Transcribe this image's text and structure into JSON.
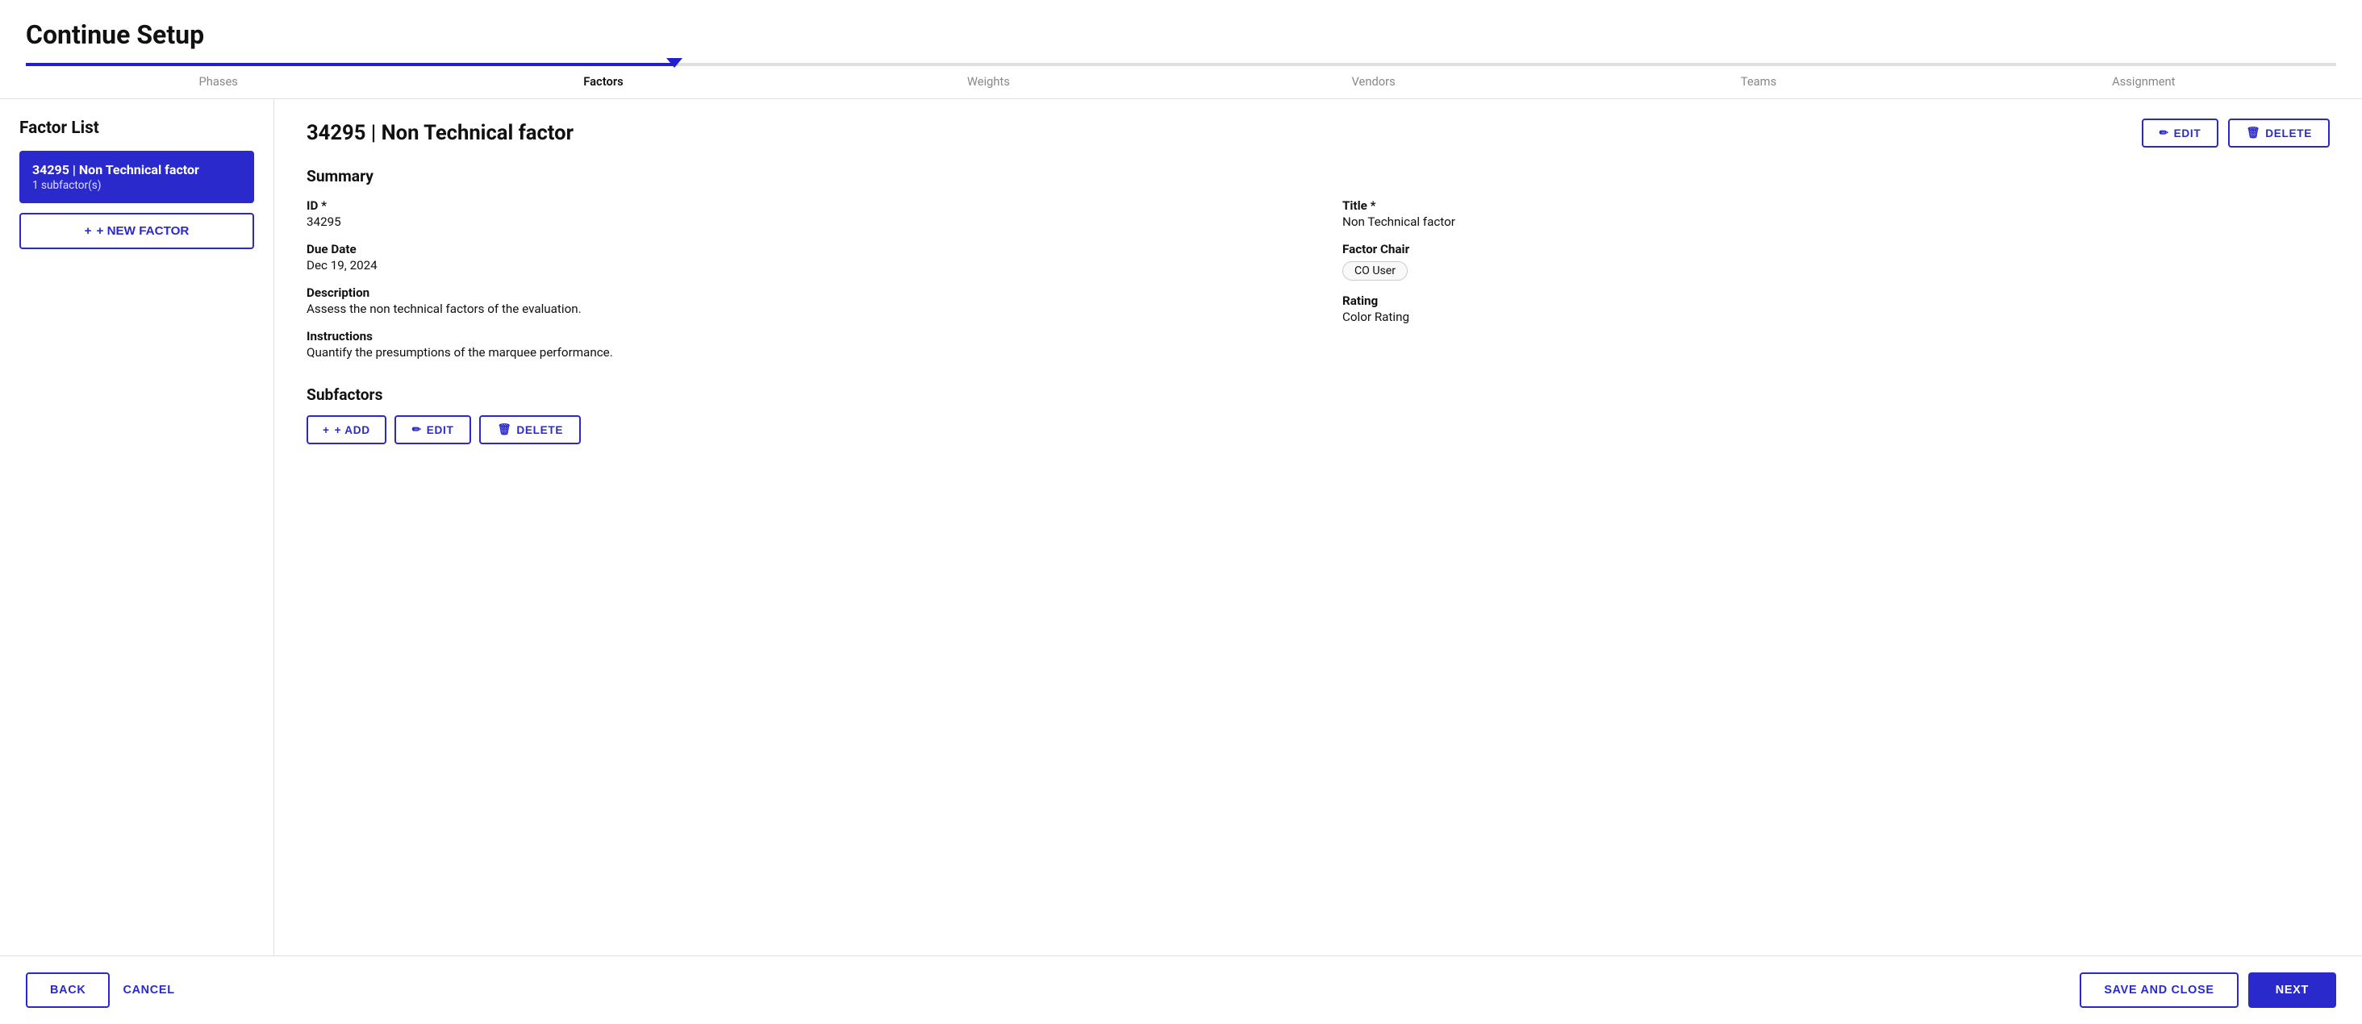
{
  "page": {
    "title": "Continue Setup"
  },
  "stepper": {
    "steps": [
      {
        "label": "Phases",
        "active": false
      },
      {
        "label": "Factors",
        "active": true
      },
      {
        "label": "Weights",
        "active": false
      },
      {
        "label": "Vendors",
        "active": false
      },
      {
        "label": "Teams",
        "active": false
      },
      {
        "label": "Assignment",
        "active": false
      }
    ],
    "progress_pct": "28%"
  },
  "sidebar": {
    "title": "Factor List",
    "items": [
      {
        "id": "34295",
        "name": "34295 | Non Technical factor",
        "subfactors": "1 subfactor(s)"
      }
    ],
    "new_factor_label": "+ NEW FACTOR"
  },
  "detail": {
    "header_title": "34295 | Non Technical factor",
    "edit_label": "EDIT",
    "delete_label": "DELETE",
    "summary_title": "Summary",
    "fields": {
      "id_label": "ID *",
      "id_value": "34295",
      "title_label": "Title *",
      "title_value": "Non Technical factor",
      "due_date_label": "Due Date",
      "due_date_value": "Dec 19, 2024",
      "factor_chair_label": "Factor Chair",
      "factor_chair_chip": "CO User",
      "description_label": "Description",
      "description_value": "Assess the non technical factors of the evaluation.",
      "rating_label": "Rating",
      "rating_value": "Color Rating",
      "instructions_label": "Instructions",
      "instructions_value": "Quantify the presumptions of the marquee performance."
    },
    "subfactors_title": "Subfactors",
    "subfactors_add": "+ ADD",
    "subfactors_edit": "EDIT",
    "subfactors_delete": "DELETE"
  },
  "bottom_bar": {
    "back_label": "BACK",
    "cancel_label": "CANCEL",
    "save_close_label": "SAVE AND CLOSE",
    "next_label": "NEXT"
  },
  "icons": {
    "pencil": "✏",
    "trash": "🗑",
    "plus": "+"
  }
}
